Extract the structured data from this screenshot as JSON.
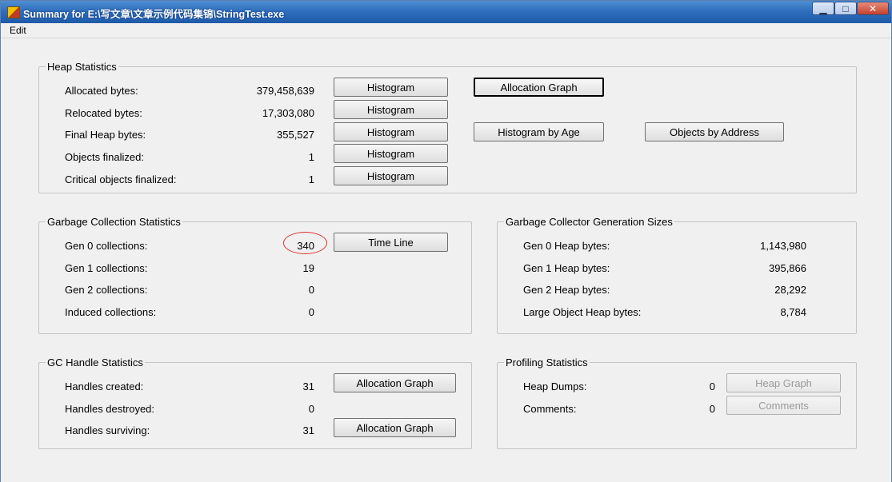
{
  "window": {
    "title": "Summary for E:\\写文章\\文章示例代码集锦\\StringTest.exe",
    "controls": {
      "minimize": "▁",
      "maximize": "□",
      "close": "✕"
    }
  },
  "menu": {
    "edit": "Edit"
  },
  "heap_statistics": {
    "title": "Heap Statistics",
    "rows": [
      {
        "label": "Allocated bytes:",
        "value": "379,458,639",
        "button": "Histogram"
      },
      {
        "label": "Relocated bytes:",
        "value": "17,303,080",
        "button": "Histogram"
      },
      {
        "label": "Final Heap bytes:",
        "value": "355,527",
        "button": "Histogram"
      },
      {
        "label": "Objects finalized:",
        "value": "1",
        "button": "Histogram"
      },
      {
        "label": "Critical objects finalized:",
        "value": "1",
        "button": "Histogram"
      }
    ],
    "allocation_graph": "Allocation Graph",
    "histogram_by_age": "Histogram by Age",
    "objects_by_address": "Objects by Address"
  },
  "gc_statistics": {
    "title": "Garbage Collection Statistics",
    "rows": [
      {
        "label": "Gen 0 collections:",
        "value": "340"
      },
      {
        "label": "Gen 1 collections:",
        "value": "19"
      },
      {
        "label": "Gen 2 collections:",
        "value": "0"
      },
      {
        "label": "Induced collections:",
        "value": "0"
      }
    ],
    "time_line": "Time Line"
  },
  "gen_sizes": {
    "title": "Garbage Collector Generation Sizes",
    "rows": [
      {
        "label": "Gen 0 Heap bytes:",
        "value": "1,143,980"
      },
      {
        "label": "Gen 1 Heap bytes:",
        "value": "395,866"
      },
      {
        "label": "Gen 2 Heap bytes:",
        "value": "28,292"
      },
      {
        "label": "Large Object Heap bytes:",
        "value": "8,784"
      }
    ]
  },
  "handle_statistics": {
    "title": "GC Handle Statistics",
    "rows": [
      {
        "label": "Handles created:",
        "value": "31"
      },
      {
        "label": "Handles destroyed:",
        "value": "0"
      },
      {
        "label": "Handles surviving:",
        "value": "31"
      }
    ],
    "allocation_graph_created": "Allocation Graph",
    "allocation_graph_surviving": "Allocation Graph"
  },
  "profiling_statistics": {
    "title": "Profiling Statistics",
    "rows": [
      {
        "label": "Heap Dumps:",
        "value": "0"
      },
      {
        "label": "Comments:",
        "value": "0"
      }
    ],
    "heap_graph": "Heap Graph",
    "comments_button": "Comments"
  }
}
